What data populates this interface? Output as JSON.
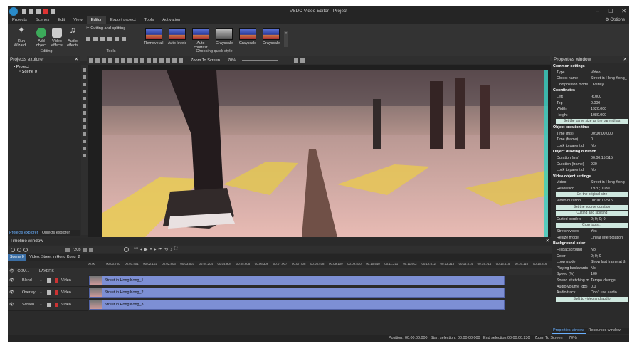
{
  "app": {
    "title": "VSDC Video Editor - Project"
  },
  "menu": {
    "items": [
      "Projects",
      "Scenes",
      "Edit",
      "View",
      "Editor",
      "Export project",
      "Tools",
      "Activation"
    ],
    "options": "Options"
  },
  "ribbon": {
    "run_wizard": "Run Wizard...",
    "add_object": "Add object",
    "video_effects": "Video effects",
    "audio_effects": "Audio effects",
    "editing_group": "Editing",
    "cutting": "Cutting and splitting",
    "tools_group": "Tools",
    "quick_style_group": "Choosing quick style",
    "quick_styles": [
      "Remove all",
      "Auto levels",
      "Auto contrast",
      "Grayscale",
      "Grayscale",
      "Grayscale"
    ]
  },
  "left_panel": {
    "title": "Projects explorer",
    "tree": [
      "Project",
      "Scene 0"
    ],
    "tabs": [
      "Projects explorer",
      "Objects explorer"
    ]
  },
  "toolbar": {
    "zoom_label": "Zoom To Screen",
    "zoom_value": "70%"
  },
  "properties": {
    "title": "Properties window",
    "rows": [
      {
        "k": "Common settings",
        "sec": true
      },
      {
        "k": "Type",
        "v": "Video"
      },
      {
        "k": "Object name",
        "v": "Street in Hong Kong_"
      },
      {
        "k": "Composition mode",
        "v": "Overlay"
      },
      {
        "k": "Coordinates",
        "sec": true
      },
      {
        "k": "Left",
        "v": "-6.000"
      },
      {
        "k": "Top",
        "v": "0.000"
      },
      {
        "k": "Width",
        "v": "1920.000"
      },
      {
        "k": "Height",
        "v": "1080.000"
      },
      {
        "btn": "Set the same size as the parent has"
      },
      {
        "k": "Object creation time",
        "sec": true
      },
      {
        "k": "Time (ms)",
        "v": "00:00:00.000"
      },
      {
        "k": "Time (frame)",
        "v": "0"
      },
      {
        "k": "Lock to parent d",
        "v": "No"
      },
      {
        "k": "Object drawing duration",
        "sec": true
      },
      {
        "k": "Duration (ms)",
        "v": "00:00:15.515"
      },
      {
        "k": "Duration (frame)",
        "v": "930"
      },
      {
        "k": "Lock to parent d",
        "v": "No"
      },
      {
        "k": "Video object settings",
        "sec": true
      },
      {
        "k": "Video",
        "v": "Street in Hong Kong"
      },
      {
        "k": "Resolution",
        "v": "1920; 1080"
      },
      {
        "btn": "Set the original size"
      },
      {
        "k": "Video duration",
        "v": "00:00:15.515"
      },
      {
        "btn": "Set the source duration"
      },
      {
        "btn": "Cutting and splitting"
      },
      {
        "k": "Cutted borders",
        "v": "0; 0; 0; 0"
      },
      {
        "btn": "Crop tools..."
      },
      {
        "k": "Stretch video",
        "v": "Yes"
      },
      {
        "k": "Resize mode",
        "v": "Linear interpolation"
      },
      {
        "k": "Background color",
        "sec": true
      },
      {
        "k": "Fill background",
        "v": "No"
      },
      {
        "k": "Color",
        "v": "0; 0; 0"
      },
      {
        "k": "Loop mode",
        "v": "Show last frame at th"
      },
      {
        "k": "Playing backwards",
        "v": "No"
      },
      {
        "k": "Speed (%)",
        "v": "100"
      },
      {
        "k": "Sound stretching m",
        "v": "Tempo change"
      },
      {
        "k": "Audio volume (dB)",
        "v": "0.0"
      },
      {
        "k": "Audio track",
        "v": "Don't use audio"
      },
      {
        "btn": "Split to video and audio"
      }
    ],
    "tabs": [
      "Properties window",
      "Resources window"
    ]
  },
  "timeline": {
    "title": "Timeline window",
    "resolution": "720p",
    "tabs": [
      "Scene 0",
      "Video: Street in Hong Kong_2"
    ],
    "header": {
      "com": "COM...",
      "layers": "LAYERS"
    },
    "ruler": [
      "00:00",
      "00:00.700",
      "00:01.401",
      "00:02.102",
      "00:02.803",
      "00:03.503",
      "00:04.204",
      "00:04.904",
      "00:05.605",
      "00:06.306",
      "00:07.007",
      "00:07.708",
      "00:08.408",
      "00:09.109",
      "00:09.810",
      "00:10.510",
      "00:11.211",
      "00:11.912",
      "00:12.612",
      "00:13.313",
      "00:14.014",
      "00:14.714",
      "00:15.415",
      "00:16.116",
      "00:16.816"
    ],
    "tracks": [
      {
        "mode": "Blend",
        "type": "Video",
        "clip": "Street in Hong Kong_1"
      },
      {
        "mode": "Overlay",
        "type": "Video",
        "clip": "Street in Hong Kong_2"
      },
      {
        "mode": "Screen",
        "type": "Video",
        "clip": "Street in Hong Kong_3"
      }
    ]
  },
  "status": {
    "position_label": "Position:",
    "position": "00:00:00.000",
    "start_label": "Start selection:",
    "start": "00:00:00.000",
    "end_label": "End selection:",
    "end": "00:00:00.230",
    "zoom_label": "Zoom To Screen",
    "zoom": "70%"
  }
}
